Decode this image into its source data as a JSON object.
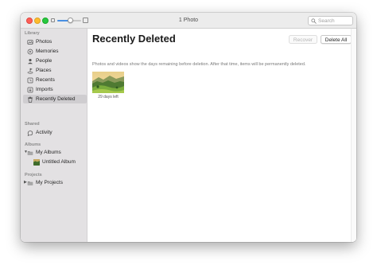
{
  "window": {
    "title": "1 Photo",
    "zoom_level": 0.55
  },
  "search": {
    "placeholder": "Search"
  },
  "sidebar": {
    "sections": {
      "library": "Library",
      "shared": "Shared",
      "albums": "Albums",
      "projects": "Projects"
    },
    "library_items": [
      {
        "label": "Photos",
        "icon": "photos-icon"
      },
      {
        "label": "Memories",
        "icon": "memories-icon"
      },
      {
        "label": "People",
        "icon": "people-icon"
      },
      {
        "label": "Places",
        "icon": "places-icon"
      },
      {
        "label": "Recents",
        "icon": "recents-icon"
      },
      {
        "label": "Imports",
        "icon": "imports-icon"
      },
      {
        "label": "Recently Deleted",
        "icon": "trash-icon",
        "selected": true
      }
    ],
    "shared_items": [
      {
        "label": "Activity",
        "icon": "activity-icon"
      }
    ],
    "album_folder": {
      "label": "My Albums",
      "expanded": true
    },
    "album_children": [
      {
        "label": "Untitled Album"
      }
    ],
    "project_folder": {
      "label": "My Projects",
      "expanded": false
    }
  },
  "main": {
    "title": "Recently Deleted",
    "recover_label": "Recover",
    "delete_all_label": "Delete All",
    "info": "Photos and videos show the days remaining before deletion. After that time, items will be permanently deleted.",
    "photos": [
      {
        "days_left": "29 days left"
      }
    ]
  },
  "colors": {
    "sidebar_bg": "#e3e1e3",
    "selection": "#cfcdd0",
    "close": "#fe5f57",
    "minimize": "#febc2e",
    "maximize": "#28c840",
    "accent": "#4a90e2"
  }
}
